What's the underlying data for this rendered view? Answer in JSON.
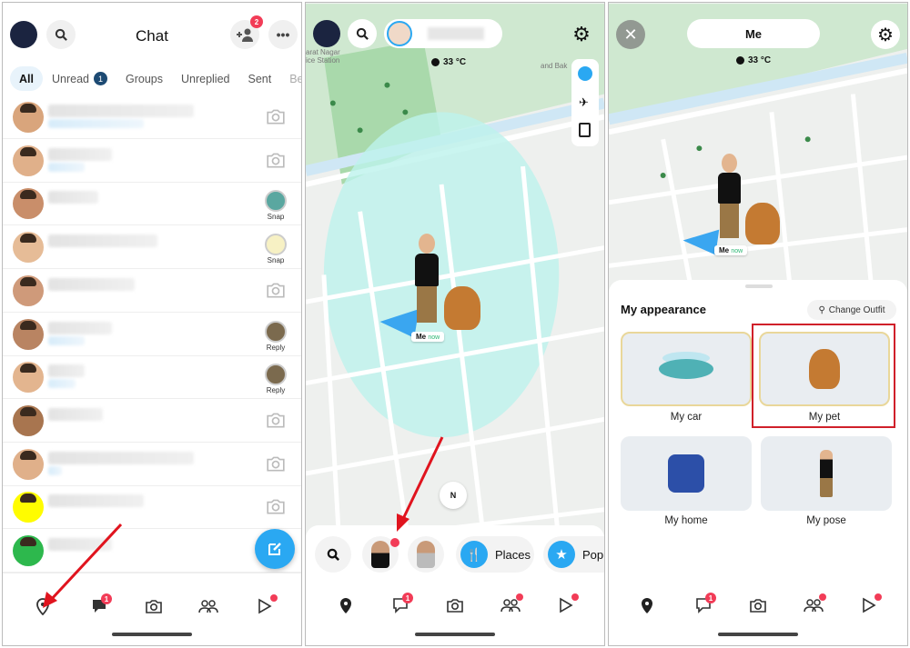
{
  "chat": {
    "title": "Chat",
    "add_friend_badge": "2",
    "tabs": [
      {
        "label": "All",
        "active": true
      },
      {
        "label": "Unread",
        "badge": "1"
      },
      {
        "label": "Groups"
      },
      {
        "label": "Unreplied"
      },
      {
        "label": "Sent"
      },
      {
        "label": "Be"
      }
    ],
    "rows": [
      {
        "action": "camera"
      },
      {
        "action": "camera"
      },
      {
        "action": "Snap"
      },
      {
        "action": "Snap"
      },
      {
        "action": "camera"
      },
      {
        "action": "Reply"
      },
      {
        "action": "Reply"
      },
      {
        "action": "camera"
      },
      {
        "action": "camera"
      },
      {
        "action": "camera"
      },
      {
        "action": "none"
      }
    ],
    "nav": {
      "chat_badge": "1"
    }
  },
  "map": {
    "place_label_1": "arat Nagar",
    "place_label_2": "ice Station",
    "place_label_3": "and Bak",
    "weather": "33 °C",
    "me_label": "Me",
    "me_status": "now",
    "quick": {
      "places": "Places",
      "popular": "Popu"
    },
    "chat_badge": "1"
  },
  "appearance": {
    "header": "Me",
    "weather": "33 °C",
    "me_label": "Me",
    "me_status": "now",
    "title": "My appearance",
    "change_outfit": "Change Outfit",
    "items": [
      {
        "label": "My car"
      },
      {
        "label": "My pet",
        "highlighted": true
      },
      {
        "label": "My home"
      },
      {
        "label": "My pose"
      }
    ],
    "chat_badge": "1"
  },
  "colors": {
    "accent": "#2aa8f2",
    "badge": "#f23c57",
    "highlight": "#d0202a",
    "annotation_arrow": "#e0141e"
  }
}
